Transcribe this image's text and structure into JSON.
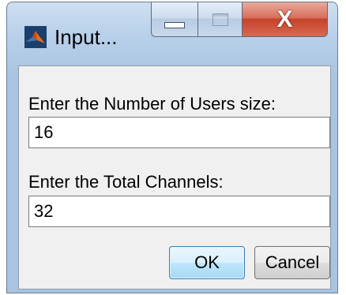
{
  "window": {
    "title": "Input...",
    "icon": "matlab-icon",
    "caption_buttons": {
      "minimize_icon": "minimize-icon",
      "maximize_icon": "maximize-icon",
      "close_icon": "close-icon",
      "close_glyph": "X"
    }
  },
  "form": {
    "fields": [
      {
        "prompt": "Enter the Number of Users size:",
        "value": "16"
      },
      {
        "prompt": "Enter the Total Channels:",
        "value": "32"
      }
    ]
  },
  "buttons": {
    "ok_label": "OK",
    "cancel_label": "Cancel"
  },
  "colors": {
    "ok_border": "#3c7fb1",
    "close_red": "#c4432b",
    "frame_blue": "#b9d1ea"
  }
}
